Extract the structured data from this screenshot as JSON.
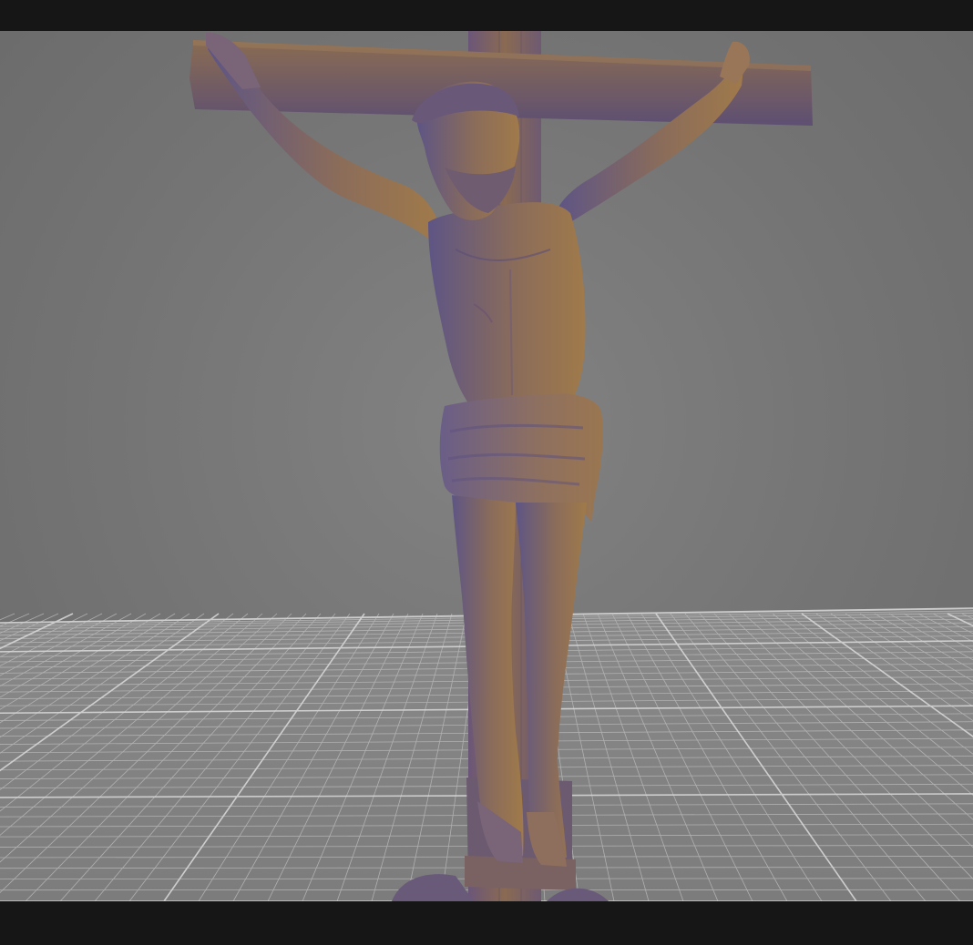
{
  "viewport": {
    "background_color": "#7a7a7a",
    "grid_color": "#c8c8c8",
    "model_color": "#6f5f8a",
    "model_highlight_color": "#a07a4a",
    "subject": "crucifix-3d-model"
  },
  "toolbar_top": {},
  "toolbar_bottom": {}
}
